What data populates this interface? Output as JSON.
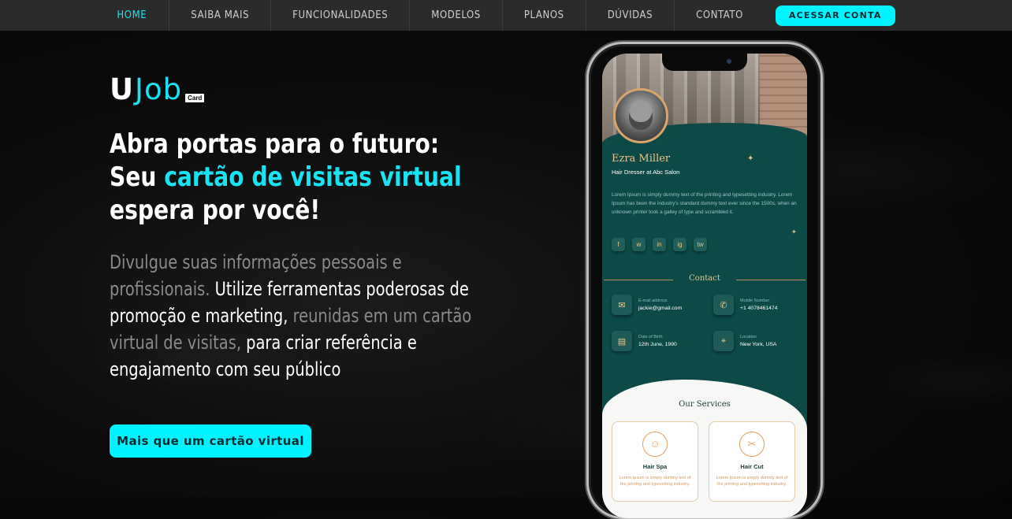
{
  "nav": {
    "items": [
      "HOME",
      "SAIBA MAIS",
      "FUNCIONALIDADES",
      "MODELOS",
      "PLANOS",
      "DÚVIDAS",
      "CONTATO"
    ],
    "active": "HOME",
    "cta": "ACESSAR CONTA"
  },
  "logo": {
    "u": "U",
    "job": "Job",
    "card": "Card"
  },
  "hero": {
    "headline_line1": "Abra portas para o futuro:",
    "headline_seu": "Seu ",
    "headline_accent": "cartão de visitas virtual",
    "headline_line3": "espera por você!",
    "desc_part1": "Divulgue suas informações pessoais e profissionais. ",
    "desc_part2": "Utilize ferramentas poderosas de promoção e marketing,",
    "desc_part3": " reunidas em um cartão virtual de visitas,",
    "desc_part4": " para criar referência e engajamento com seu público",
    "cta": "Mais que um cartão virtual"
  },
  "phone": {
    "name": "Ezra Miller",
    "role": "Hair Dresser at Abc Salon",
    "bio": "Lorem Ipsum is simply dummy text of the printing and typesetting industry. Lorem Ipsum has been the industry's standard dummy text ever since the 1500s, when an unknown printer took a galley of type and scrambled it.",
    "socials": [
      "f",
      "w",
      "in",
      "ig",
      "tw"
    ],
    "contact_title": "Contact",
    "contacts": [
      {
        "label": "E-mail address",
        "value": "jackie@gmail.com",
        "icon": "✉"
      },
      {
        "label": "Mobile Number",
        "value": "+1 4078461474",
        "icon": "✆"
      },
      {
        "label": "Date of Birth",
        "value": "12th June, 1990",
        "icon": "▤"
      },
      {
        "label": "Location",
        "value": "New York, USA",
        "icon": "⌖"
      }
    ],
    "services_title": "Our Services",
    "services": [
      {
        "name": "Hair Spa",
        "desc": "Lorem Ipsum is simply dummy text of the printing and typesetting industry."
      },
      {
        "name": "Hair Cut",
        "desc": "Lorem Ipsum is simply dummy text of the printing and typesetting industry."
      }
    ]
  },
  "colors": {
    "accent": "#00f4ff",
    "accent_text": "#19e3f2",
    "card_teal": "#0d4a47",
    "gold": "#e9c48b"
  }
}
